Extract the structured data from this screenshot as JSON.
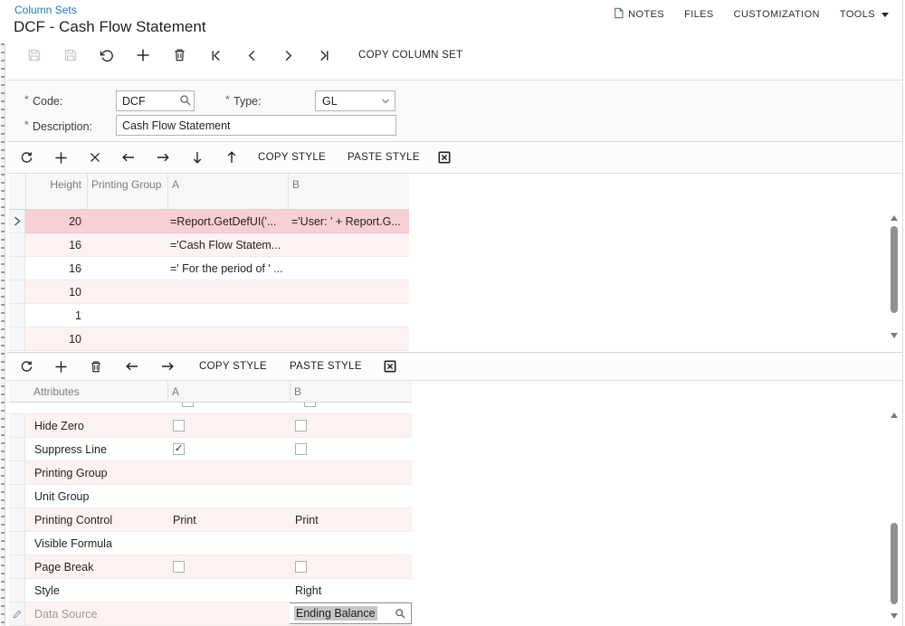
{
  "colors": {
    "link_blue": "#1779be",
    "selected_row_pink": "#f8cfd3",
    "stripe_pink": "#fdf2f1",
    "editor_selection_gray": "#c6c6c6"
  },
  "page": {
    "breadcrumb": "Column Sets",
    "title": "DCF - Cash Flow Statement"
  },
  "header_menu": {
    "notes": "NOTES",
    "files": "FILES",
    "customization": "CUSTOMIZATION",
    "tools": "TOOLS"
  },
  "main_toolbar": {
    "copy_column_set": "COPY COLUMN SET"
  },
  "form": {
    "required_marker": "*",
    "code": {
      "label": "Code:",
      "value": "DCF"
    },
    "type": {
      "label": "Type:",
      "value": "GL"
    },
    "description": {
      "label": "Description:",
      "value": "Cash Flow Statement"
    }
  },
  "rows_grid": {
    "toolbar": {
      "copy_style": "COPY STYLE",
      "paste_style": "PASTE STYLE"
    },
    "columns": {
      "height": "Height",
      "printing_group": "Printing Group",
      "a": "A",
      "b": "B"
    },
    "rows": [
      {
        "height": "20",
        "a": "=Report.GetDefUI('...",
        "b": "='User: ' + Report.G...",
        "selected": true
      },
      {
        "height": "16",
        "a": "='Cash Flow Statem..."
      },
      {
        "height": "16",
        "a": "=' For the period of ' ..."
      },
      {
        "height": "10"
      },
      {
        "height": "1"
      },
      {
        "height": "10"
      }
    ]
  },
  "attributes_grid": {
    "toolbar": {
      "copy_style": "COPY STYLE",
      "paste_style": "PASTE STYLE"
    },
    "columns": {
      "attributes": "Attributes",
      "a": "A",
      "b": "B"
    },
    "partial_row": {
      "a_checked": false,
      "b_checked": false
    },
    "rows": [
      {
        "label": "Hide Zero",
        "a_checked": false,
        "b_checked": false
      },
      {
        "label": "Suppress Line",
        "a_checked": true,
        "b_checked": false
      },
      {
        "label": "Printing Group"
      },
      {
        "label": "Unit Group"
      },
      {
        "label": "Printing Control",
        "a": "Print",
        "b": "Print"
      },
      {
        "label": "Visible Formula"
      },
      {
        "label": "Page Break",
        "a_checked": false,
        "b_checked": false
      },
      {
        "label": "Style",
        "b": "Right"
      },
      {
        "label": "Data Source",
        "b_editor": "Ending Balance"
      }
    ]
  }
}
